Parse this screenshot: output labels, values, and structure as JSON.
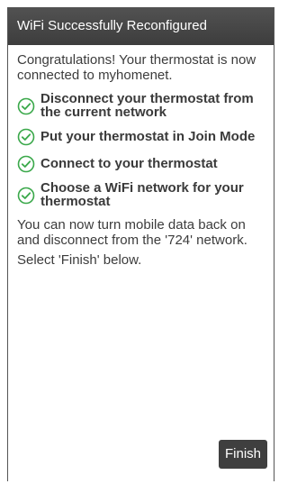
{
  "header": {
    "title": "WiFi Successfully Reconfigured"
  },
  "intro_text": "Congratulations! Your thermostat is now connected to myhomenet.",
  "steps": [
    {
      "label": "Disconnect your thermostat from the current network",
      "icon": "check-circle-icon"
    },
    {
      "label": "Put your thermostat in Join Mode",
      "icon": "check-circle-icon"
    },
    {
      "label": "Connect to your thermostat",
      "icon": "check-circle-icon"
    },
    {
      "label": "Choose a WiFi network for your thermostat",
      "icon": "check-circle-icon"
    }
  ],
  "outro_text": "You can now turn mobile data back on and disconnect from the '724' network.",
  "finish_note": "Select 'Finish' below.",
  "finish_button_label": "Finish",
  "colors": {
    "accent_green": "#3aa84a",
    "header_bg": "#474747",
    "button_bg": "#3f3f3f"
  }
}
